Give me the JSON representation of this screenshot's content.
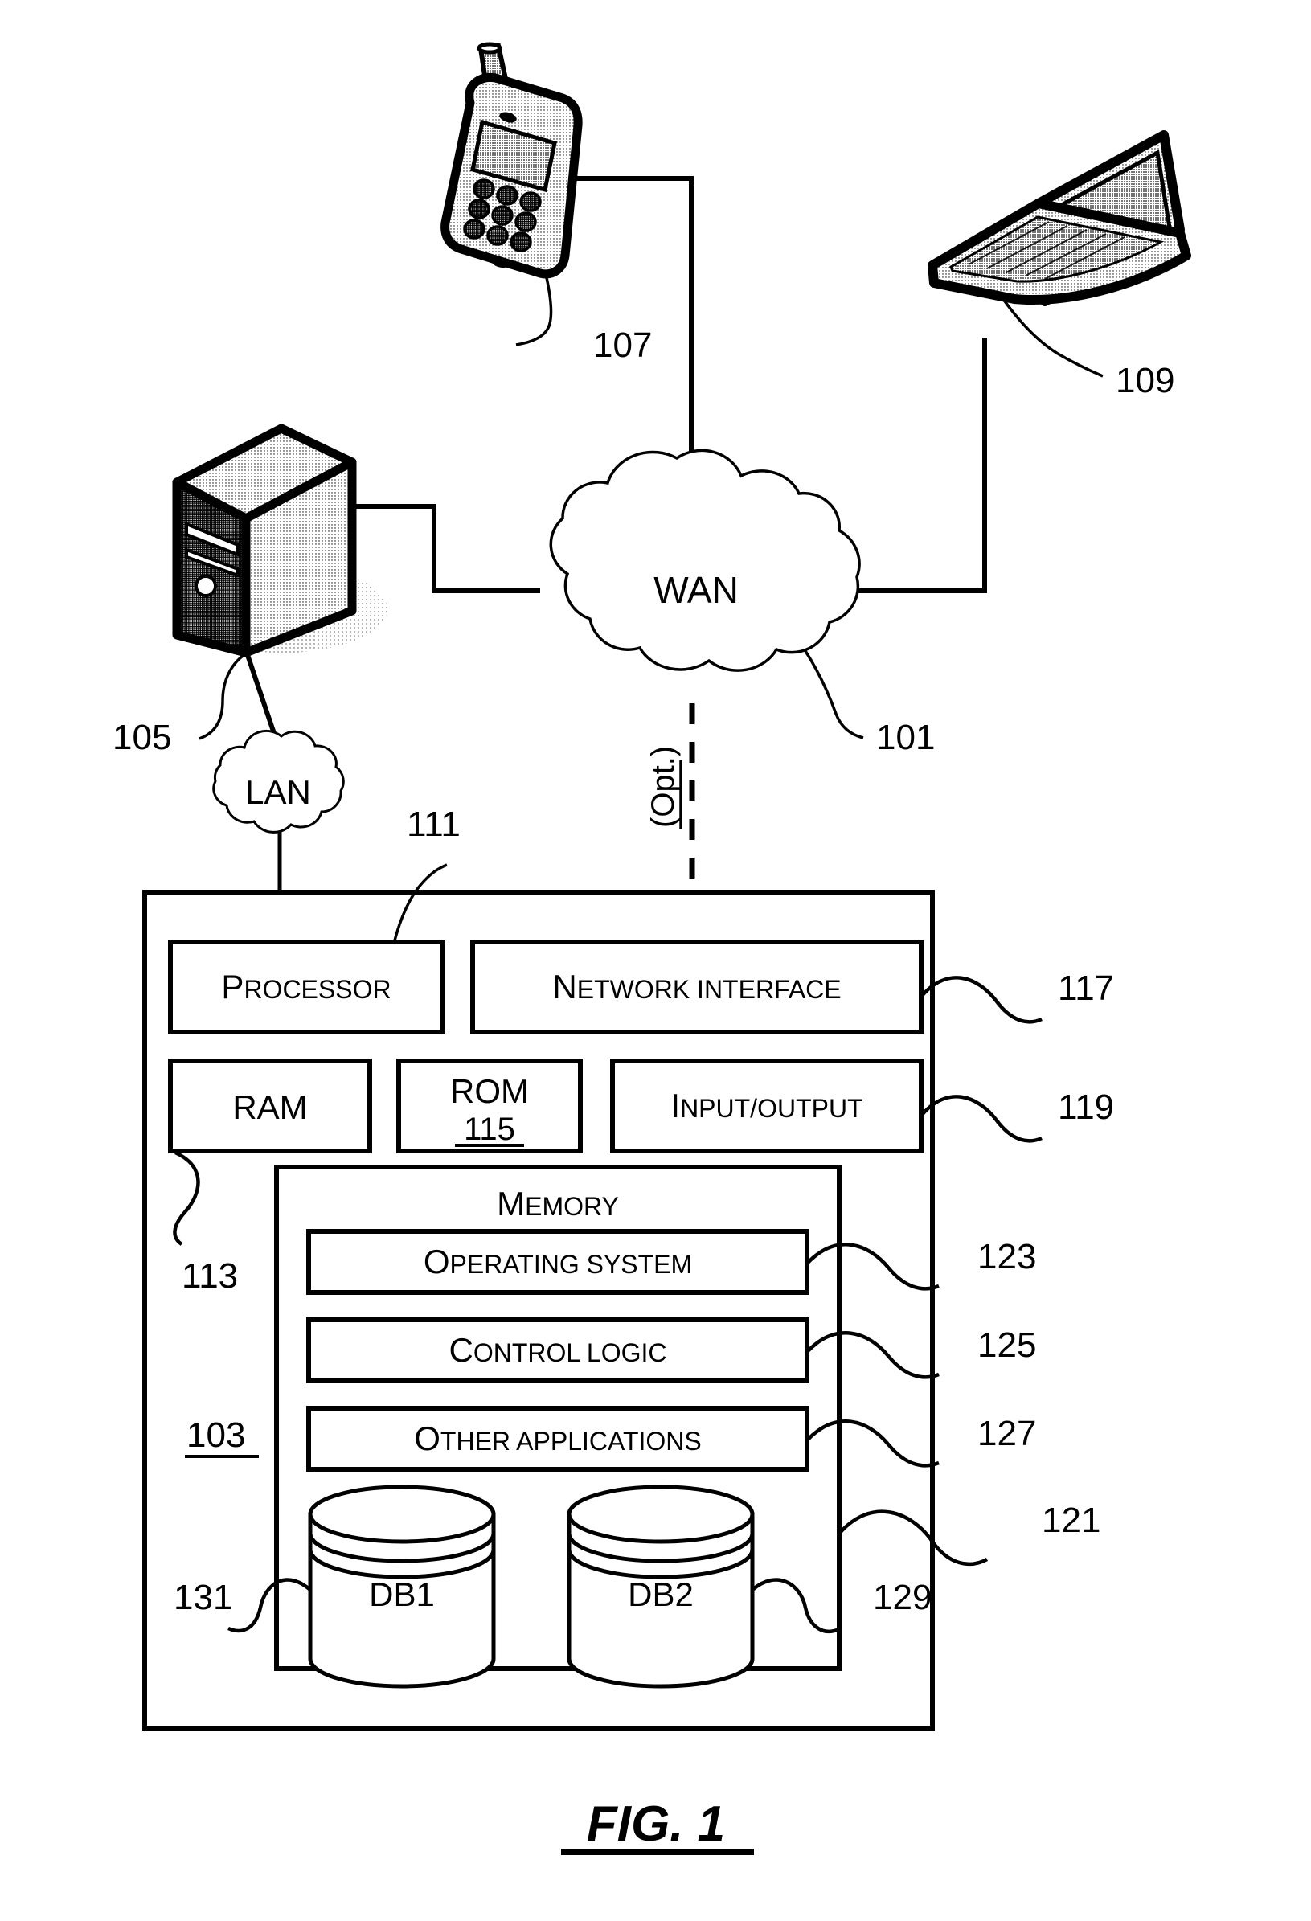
{
  "figure": {
    "caption": "FIG. 1",
    "type": "patent-network-block-diagram"
  },
  "network": {
    "wan_label": "WAN",
    "wan_ref": "101",
    "lan_label": "LAN",
    "optional_link_label": "(Opt.)"
  },
  "devices": [
    {
      "name": "mobile-phone",
      "ref": "107"
    },
    {
      "name": "laptop-computer",
      "ref": "109"
    },
    {
      "name": "server-tower",
      "ref": "105"
    }
  ],
  "computing_device": {
    "ref": "103",
    "bus_ref": "111",
    "components": [
      {
        "label_first": "P",
        "label_rest": "ROCESSOR",
        "ref": ""
      },
      {
        "label_first": "N",
        "label_rest": "ETWORK INTERFACE",
        "ref": "117"
      },
      {
        "label": "RAM",
        "ref": "113"
      },
      {
        "label": "ROM",
        "sub_ref": "115"
      },
      {
        "label_first": "I",
        "label_rest": "NPUT/OUTPUT",
        "ref": "119"
      }
    ],
    "memory": {
      "label_first": "M",
      "label_rest": "EMORY",
      "ref": "121",
      "items": [
        {
          "label_first": "O",
          "label_rest": "PERATING SYSTEM",
          "ref": "123"
        },
        {
          "label_first": "C",
          "label_rest": "ONTROL LOGIC",
          "ref": "125"
        },
        {
          "label_first": "O",
          "label_rest": "THER APPLICATIONS",
          "ref": "127"
        }
      ],
      "databases": [
        {
          "label": "DB1",
          "ref": "131"
        },
        {
          "label": "DB2",
          "ref": "129"
        }
      ]
    }
  },
  "colors": {
    "line": "#000000",
    "background": "#ffffff",
    "shade_light": "#d8d8d8",
    "shade_mid": "#a8a8a8",
    "shade_dark": "#2a2a2a"
  }
}
